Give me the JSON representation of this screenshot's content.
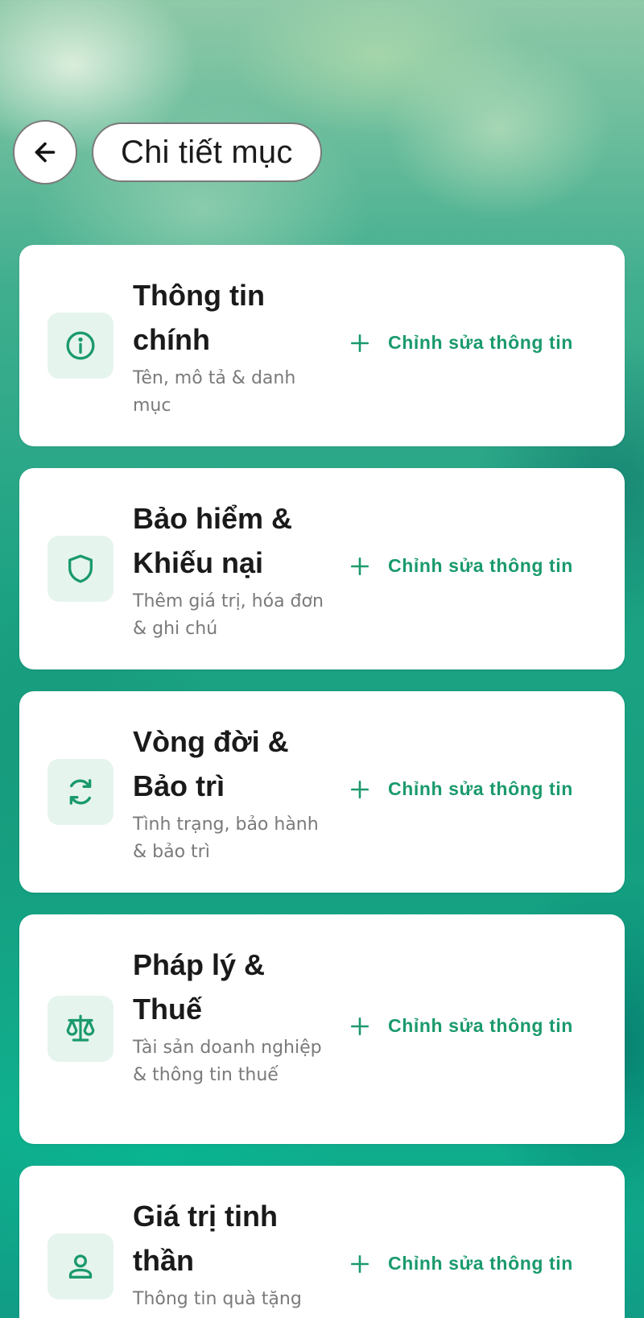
{
  "header": {
    "title": "Chi tiết mục"
  },
  "icons": {
    "back": "arrow-left-icon",
    "add": "plus-icon"
  },
  "colors": {
    "accent": "#1a9a6c",
    "icon_tile_bg": "#e6f4ee",
    "card_bg": "#ffffff"
  },
  "sections": [
    {
      "title_line1": "Thông tin",
      "title_line2": "chính",
      "subtitle": "Tên, mô tả & danh mục",
      "icon": "info-icon",
      "action": "Chỉnh sửa thông tin"
    },
    {
      "title_line1": "Bảo hiểm &",
      "title_line2": "Khiếu nại",
      "subtitle": "Thêm giá trị, hóa đơn & ghi chú",
      "icon": "shield-icon",
      "action": "Chỉnh sửa thông tin"
    },
    {
      "title_line1": "Vòng đời &",
      "title_line2": "Bảo trì",
      "subtitle": "Tình trạng, bảo hành & bảo trì",
      "icon": "refresh-icon",
      "action": "Chỉnh sửa thông tin"
    },
    {
      "title_line1": "Pháp lý &",
      "title_line2": "Thuế",
      "subtitle": "Tài sản doanh nghiệp & thông tin thuế",
      "icon": "scale-icon",
      "action": "Chỉnh sửa thông tin"
    },
    {
      "title_line1": "Giá trị tinh",
      "title_line2": "thần",
      "subtitle": "Thông tin quà tặng",
      "icon": "person-icon",
      "action": "Chỉnh sửa thông tin"
    }
  ]
}
